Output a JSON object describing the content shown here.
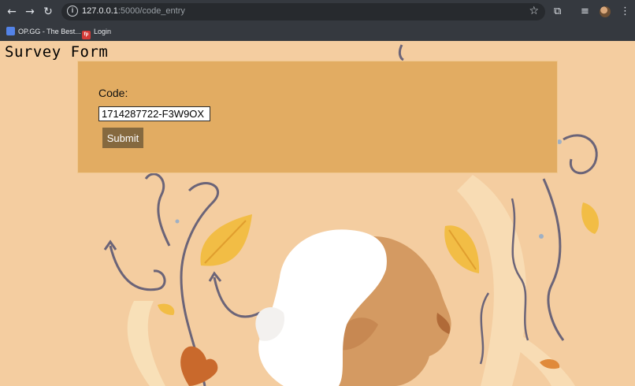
{
  "browser": {
    "url_host": "127.0.0.1",
    "url_path": ":5000/code_entry",
    "bookmarks": [
      {
        "label": "OP.GG - The Best...",
        "favicon": "OPGG",
        "color": "#5383e8"
      },
      {
        "label": "Login",
        "favicon": "fp",
        "color": "#d43a36"
      }
    ]
  },
  "page": {
    "title": "Survey Form",
    "form": {
      "code_label": "Code:",
      "code_value": "1714287722-F3W9OX",
      "submit_label": "Submit"
    }
  },
  "icons": {
    "back": "arrow-left-icon",
    "forward": "arrow-right-icon",
    "reload": "reload-icon",
    "site_info": "info-icon",
    "bookmark": "star-icon",
    "extensions": "puzzle-icon",
    "media": "media-queue-icon",
    "profile": "avatar",
    "menu": "kebab-menu-icon"
  },
  "colors": {
    "page_bg": "#f4cda0",
    "card_bg": "#e2ac62",
    "submit_bg": "#85693f",
    "leaf": "#f2bd45",
    "hair": "#ffffff",
    "skin": "#d49a62",
    "squiggle": "#6b6478"
  }
}
